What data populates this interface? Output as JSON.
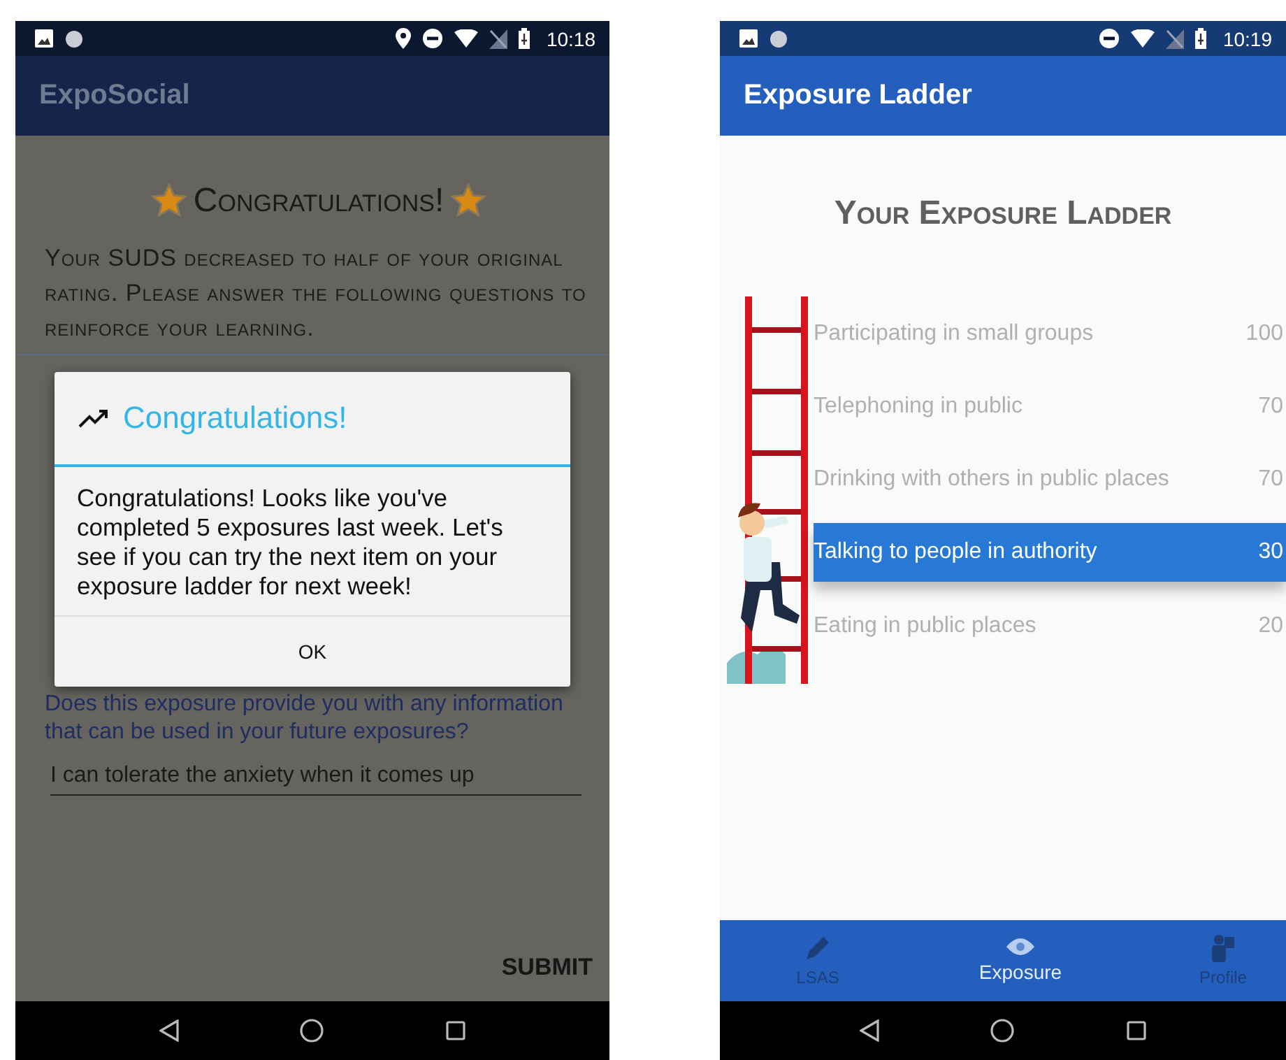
{
  "left_screen": {
    "status_bar": {
      "time": "10:18"
    },
    "app_bar": {
      "title": "ExpoSocial"
    },
    "heading": "Congratulations!",
    "intro": "Your SUDS decreased to half of your original rating. Please answer the following questions to reinforce your learning.",
    "question": "Does this exposure provide you with any information that can be used in your future exposures?",
    "answer": {
      "value": "I can tolerate the anxiety when it comes up"
    },
    "submit": "SUBMIT",
    "dialog": {
      "title": "Congratulations!",
      "message": "Congratulations! Looks like you've completed 5 exposures last week. Let's see if you can try the next item on your exposure ladder for next week!",
      "button": "OK"
    }
  },
  "right_screen": {
    "status_bar": {
      "time": "10:19"
    },
    "app_bar": {
      "title": "Exposure Ladder"
    },
    "heading": "Your Exposure Ladder",
    "items": [
      {
        "label": "Participating in small groups",
        "score": "100",
        "selected": false
      },
      {
        "label": "Telephoning in public",
        "score": "70",
        "selected": false
      },
      {
        "label": "Drinking with others in public places",
        "score": "70",
        "selected": false
      },
      {
        "label": "Talking to people in authority",
        "score": "30",
        "selected": true
      },
      {
        "label": "Eating in public places",
        "score": "20",
        "selected": false
      }
    ],
    "bottom_nav": [
      {
        "label": "LSAS",
        "kind": "pencil",
        "selected": false
      },
      {
        "label": "Exposure",
        "kind": "eye",
        "selected": true
      },
      {
        "label": "Profile",
        "kind": "profile",
        "selected": false
      }
    ]
  }
}
